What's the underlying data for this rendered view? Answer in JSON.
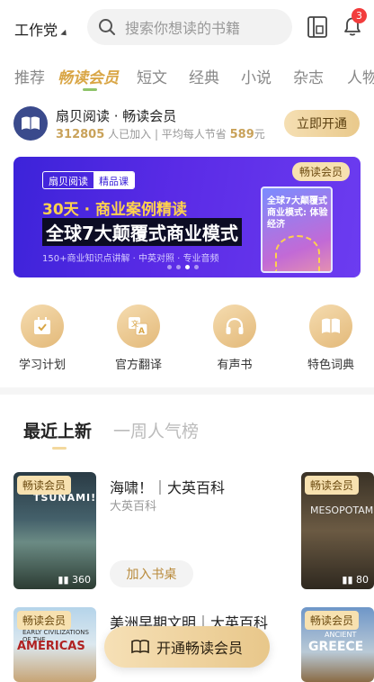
{
  "header": {
    "identity": "工作党",
    "search_placeholder": "搜索你想读的书籍",
    "notification_count": "3"
  },
  "tabs": [
    "推荐",
    "畅读会员",
    "短文",
    "经典",
    "小说",
    "杂志",
    "人物"
  ],
  "active_tab": "畅读会员",
  "member": {
    "title": "扇贝阅读 · 畅读会员",
    "count": "312805",
    "count_suffix": "人已加入",
    "save_prefix": "| 平均每人节省",
    "save_amount": "589",
    "save_unit": "元",
    "open_button": "立即开通"
  },
  "banner": {
    "tag_left": "扇贝阅读",
    "tag_right": "精品课",
    "vip_label": "畅读会员",
    "line1": "30天 · 商业案例精读",
    "line2": "全球7大颠覆式商业模式",
    "line3": "150+商业知识点讲解 · 中英对照 · 专业音频",
    "book_title": "全球7大颠覆式商业模式: 体验经济",
    "active_dot": 3
  },
  "quick_links": [
    {
      "label": "学习计划",
      "icon": "calendar-check-icon"
    },
    {
      "label": "官方翻译",
      "icon": "translate-icon"
    },
    {
      "label": "有声书",
      "icon": "headphones-icon"
    },
    {
      "label": "特色词典",
      "icon": "open-book-icon"
    }
  ],
  "list_tabs": {
    "active": "最近上新",
    "inactive": "一周人气榜"
  },
  "books": [
    {
      "badge": "畅读会员",
      "cover_title": "TSUNAMI!",
      "count": "360",
      "title": "海啸！｜大英百科",
      "subtitle": "大英百科",
      "add_button": "加入书桌"
    },
    {
      "badge": "畅读会员",
      "cover_small": "EARLY CIVILIZATIONS OF THE",
      "cover_title": "AMERICAS",
      "title": "美洲早期文明｜大英百科"
    }
  ],
  "right_books": [
    {
      "badge": "畅读会员",
      "cover_title": "MESOPOTAMIA",
      "count": "80"
    },
    {
      "badge": "畅读会员",
      "cover_small": "ANCIENT",
      "cover_title": "GREECE"
    }
  ],
  "fab": {
    "label": "开通畅读会员"
  },
  "colors": {
    "gold": "#d9a646",
    "banner_purple": "#4a27e0",
    "badge_red": "#f23c3c"
  }
}
